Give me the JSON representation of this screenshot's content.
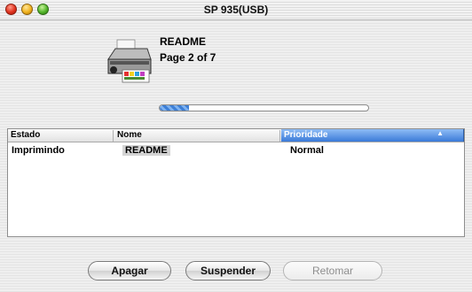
{
  "window": {
    "title": "SP 935(USB)"
  },
  "job": {
    "document_name": "README",
    "page_status": "Page 2 of 7",
    "progress_fraction": 0.14
  },
  "table": {
    "columns": [
      "Estado",
      "Nome",
      "Prioridade"
    ],
    "sorted_column": "Prioridade",
    "rows": [
      {
        "estado": "Imprimindo",
        "nome": "README",
        "prioridade": "Normal"
      }
    ]
  },
  "buttons": {
    "delete": "Apagar",
    "suspend": "Suspender",
    "resume": "Retomar"
  },
  "colors": {
    "accent": "#3a7ad8",
    "progress": "#3d7fd6"
  }
}
